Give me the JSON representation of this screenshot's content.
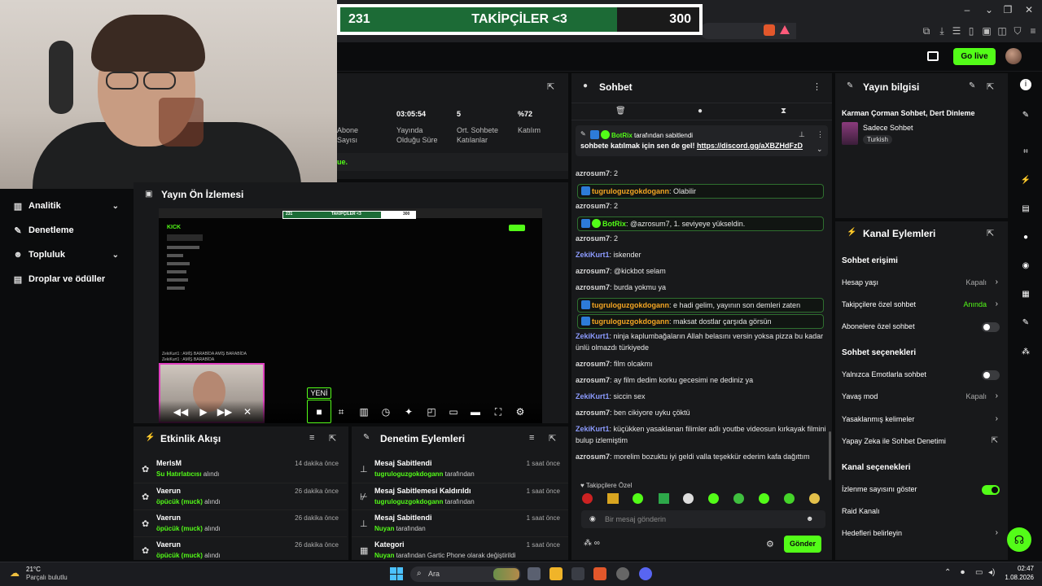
{
  "goal": {
    "current": "231",
    "title": "TAKİPÇİLER <3",
    "target": "300",
    "progress": 0.77
  },
  "header": {
    "go_live": "Go live"
  },
  "sidebar": {
    "items": [
      {
        "label": "Analitik",
        "icon": "chart-icon",
        "chevron": true
      },
      {
        "label": "Denetleme",
        "icon": "wrench-icon",
        "chevron": false
      },
      {
        "label": "Topluluk",
        "icon": "people-icon",
        "chevron": true
      },
      {
        "label": "Droplar ve ödüller",
        "icon": "gift-icon",
        "chevron": false
      }
    ]
  },
  "stats": {
    "items": [
      {
        "value": "",
        "label": "Abone Sayısı"
      },
      {
        "value": "03:05:54",
        "label": "Yayında Olduğu Süre"
      },
      {
        "value": "5",
        "label": "Ort. Sohbete Katılanlar"
      },
      {
        "value": "%72",
        "label": "Katılım"
      }
    ],
    "footer_fragment": "ue."
  },
  "preview": {
    "title": "Yayın Ön İzlemesi",
    "new_badge": "YENİ",
    "mini": {
      "goal_left": "231",
      "goal_title": "TAKİPÇİLER <3",
      "goal_right": "300",
      "logo": "KICK",
      "chat1": "ZekiKurt1 : AMİŞ BARABİDA AMİŞ BARABİDA",
      "chat2": "ZekiKurt1 : AMİŞ BARABİDA"
    }
  },
  "activity": {
    "title": "Etkinlik Akışı",
    "rows": [
      {
        "name": "MerlsM",
        "detail_highlight": "Su Hatırlatıcısı",
        "detail_rest": " alındı",
        "time": "14 dakika önce"
      },
      {
        "name": "Vaerun",
        "detail_highlight": "öpücük (muck)",
        "detail_rest": " alındı",
        "time": "26 dakika önce"
      },
      {
        "name": "Vaerun",
        "detail_highlight": "öpücük (muck)",
        "detail_rest": " alındı",
        "time": "26 dakika önce"
      },
      {
        "name": "Vaerun",
        "detail_highlight": "öpücük (muck)",
        "detail_rest": " alındı",
        "time": "26 dakika önce"
      }
    ]
  },
  "moderation": {
    "title": "Denetim Eylemleri",
    "rows": [
      {
        "name": "Mesaj Sabitlendi",
        "detail_highlight": "tugruloguzgokdogann",
        "detail_rest": " tarafından",
        "time": "1 saat önce"
      },
      {
        "name": "Mesaj Sabitlemesi Kaldırıldı",
        "detail_highlight": "tugruloguzgokdogann",
        "detail_rest": " tarafından",
        "time": "1 saat önce"
      },
      {
        "name": "Mesaj Sabitlendi",
        "detail_highlight": "Nuyan",
        "detail_rest": " tarafından",
        "time": "1 saat önce"
      },
      {
        "name": "Kategori",
        "detail_highlight": "Nuyan",
        "detail_rest": " tarafından Gartic Phone olarak değiştirildi",
        "time": "1 saat önce"
      }
    ]
  },
  "chat": {
    "title": "Sohbet",
    "pinned_by_user": "BotRix",
    "pinned_by_rest": " tarafından sabitlendi",
    "pinned_text": "sohbete katılmak için sen de gel! ",
    "pinned_link": "https://discord.gg/aXBZHdFzD",
    "messages": [
      {
        "user": "azrosum7",
        "color": "#d9d9d9",
        "text": ": 2",
        "boxed": false,
        "badge": ""
      },
      {
        "user": "tugruloguzgokdogann",
        "color": "#f5a623",
        "text": ": Olabilir",
        "boxed": true,
        "badge": "blue"
      },
      {
        "user": "azrosum7",
        "color": "#d9d9d9",
        "text": ": 2",
        "boxed": false,
        "badge": ""
      },
      {
        "user": "BotRix",
        "color": "#53fc18",
        "text": ": @azrosum7, 1. seviyeye yükseldin.",
        "boxed": true,
        "badge": "bot"
      },
      {
        "user": "azrosum7",
        "color": "#d9d9d9",
        "text": ": 2",
        "boxed": false,
        "badge": ""
      },
      {
        "user": "ZekiKurt1",
        "color": "#8c9bff",
        "text": ": iskender",
        "boxed": false,
        "badge": ""
      },
      {
        "user": "azrosum7",
        "color": "#d9d9d9",
        "text": ": @kickbot selam",
        "boxed": false,
        "badge": ""
      },
      {
        "user": "azrosum7",
        "color": "#d9d9d9",
        "text": ": burda yokmu ya",
        "boxed": false,
        "badge": ""
      },
      {
        "user": "tugruloguzgokdogann",
        "color": "#f5a623",
        "text": ": e hadi gelim, yayının son demleri zaten",
        "boxed": true,
        "badge": "blue"
      },
      {
        "user": "tugruloguzgokdogann",
        "color": "#f5a623",
        "text": ": maksat dostlar çarşıda görsün",
        "boxed": true,
        "badge": "blue"
      },
      {
        "user": "ZekiKurt1",
        "color": "#8c9bff",
        "text": ": ninja kaplumbağaların Allah belasını versin yoksa pizza bu kadar ünlü olmazdı türkiyede",
        "boxed": false,
        "badge": ""
      },
      {
        "user": "azrosum7",
        "color": "#d9d9d9",
        "text": ": film olcakmı",
        "boxed": false,
        "badge": ""
      },
      {
        "user": "azrosum7",
        "color": "#d9d9d9",
        "text": ": ay film dedim korku gecesimi ne dediniz ya",
        "boxed": false,
        "badge": ""
      },
      {
        "user": "ZekiKurt1",
        "color": "#8c9bff",
        "text": ": siccin sex",
        "boxed": false,
        "badge": ""
      },
      {
        "user": "azrosum7",
        "color": "#d9d9d9",
        "text": ": ben cikiyore uyku çöktü",
        "boxed": false,
        "badge": ""
      },
      {
        "user": "ZekiKurt1",
        "color": "#8c9bff",
        "text": ": küçükken yasaklanan filimler adlı youtbe videosun kırkayak filmini bulup izlemiştim",
        "boxed": false,
        "badge": ""
      },
      {
        "user": "azrosum7",
        "color": "#d9d9d9",
        "text": ": morelim bozuktu iyi geldi valla teşekkür ederim kafa dağıttım",
        "boxed": false,
        "badge": ""
      }
    ],
    "followers_only": "Takipçilere Özel",
    "input_placeholder": "Bir mesaj gönderin",
    "send": "Gönder"
  },
  "stream_info": {
    "title": "Yayın bilgisi",
    "stream_title": "Karman Çorman Sohbet, Dert Dinleme",
    "category": "Sadece Sohbet",
    "tag": "Turkish"
  },
  "channel_actions": {
    "title": "Kanal Eylemleri",
    "chat_access": "Sohbet erişimi",
    "account_age": {
      "label": "Hesap yaşı",
      "value": "Kapalı"
    },
    "followers_chat": {
      "label": "Takipçilere özel sohbet",
      "value": "Anında"
    },
    "subs_chat": {
      "label": "Abonelere özel sohbet",
      "on": false
    },
    "chat_options": "Sohbet seçenekleri",
    "emote_only": {
      "label": "Yalnızca Emotlarla sohbet",
      "on": false
    },
    "slow_mode": {
      "label": "Yavaş mod",
      "value": "Kapalı"
    },
    "banned_words": {
      "label": "Yasaklanmış kelimeler"
    },
    "ai_mod": {
      "label": "Yapay Zeka ile Sohbet Denetimi"
    },
    "channel_options": "Kanal seçenekleri",
    "show_viewers": {
      "label": "İzlenme sayısını göster",
      "on": true
    },
    "raid": {
      "label": "Raid Kanalı"
    },
    "goals": {
      "label": "Hedefleri belirleyin"
    }
  },
  "taskbar": {
    "temp": "21°C",
    "weather": "Parçalı bulutlu",
    "search": "Ara",
    "time": "02:47",
    "date": "1.08.2026"
  },
  "colors": {
    "accent": "#53fc18",
    "panel": "#18191b",
    "goal_fill": "#1c6b36"
  }
}
